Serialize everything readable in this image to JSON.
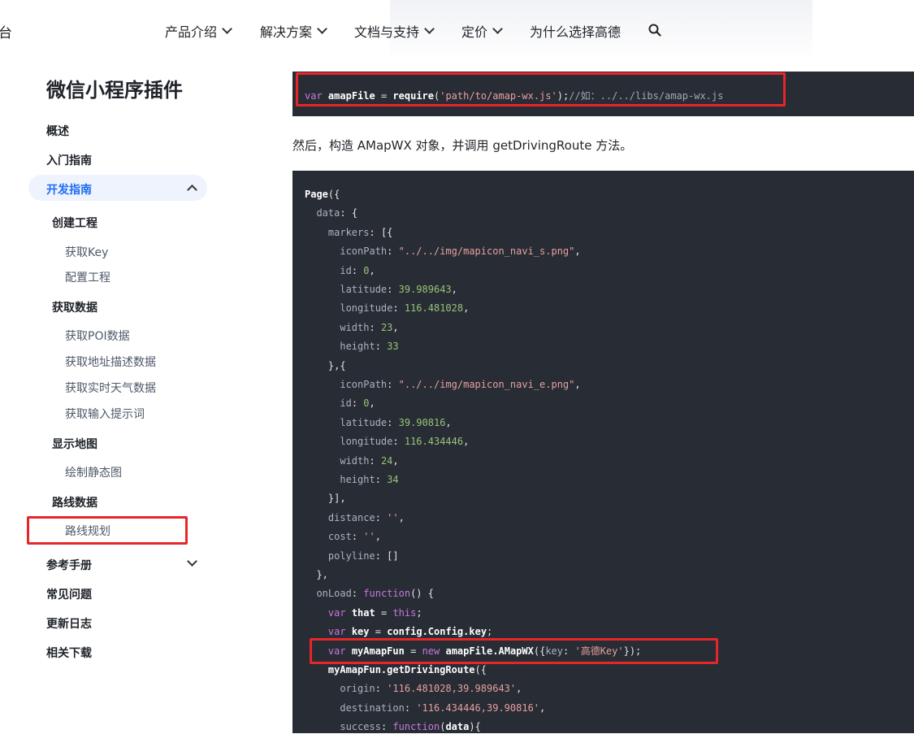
{
  "nav": {
    "logo_fragment": "台",
    "items": [
      "产品介绍",
      "解决方案",
      "文档与支持",
      "定价",
      "为什么选择高德"
    ]
  },
  "sidebar": {
    "title": "微信小程序插件",
    "items": [
      {
        "label": "概述"
      },
      {
        "label": "入门指南"
      },
      {
        "label": "开发指南"
      },
      {
        "label": "创建工程"
      },
      {
        "label": "获取Key"
      },
      {
        "label": "配置工程"
      },
      {
        "label": "获取数据"
      },
      {
        "label": "获取POI数据"
      },
      {
        "label": "获取地址描述数据"
      },
      {
        "label": "获取实时天气数据"
      },
      {
        "label": "获取输入提示词"
      },
      {
        "label": "显示地图"
      },
      {
        "label": "绘制静态图"
      },
      {
        "label": "路线数据"
      },
      {
        "label": "路线规划"
      },
      {
        "label": "参考手册"
      },
      {
        "label": "常见问题"
      },
      {
        "label": "更新日志"
      },
      {
        "label": "相关下载"
      }
    ]
  },
  "content": {
    "code_require": "var amapFile = require('path/to/amap-wx.js');//如：../../libs/amap-wx.js",
    "paragraph": "然后，构造 AMapWX 对象，并调用 getDrivingRoute 方法。",
    "code_lines": [
      "Page({",
      "  data: {",
      "    markers: [{",
      "      iconPath: \"../../img/mapicon_navi_s.png\",",
      "      id: 0,",
      "      latitude: 39.989643,",
      "      longitude: 116.481028,",
      "      width: 23,",
      "      height: 33",
      "    },{",
      "      iconPath: \"../../img/mapicon_navi_e.png\",",
      "      id: 0,",
      "      latitude: 39.90816,",
      "      longitude: 116.434446,",
      "      width: 24,",
      "      height: 34",
      "    }],",
      "    distance: '',",
      "    cost: '',",
      "    polyline: []",
      "  },",
      "  onLoad: function() {",
      "    var that = this;",
      "    var key = config.Config.key;",
      "    var myAmapFun = new amapFile.AMapWX({key: '高德Key'});",
      "    myAmapFun.getDrivingRoute({",
      "      origin: '116.481028,39.989643',",
      "      destination: '116.434446,39.90816',",
      "      success: function(data){"
    ]
  }
}
